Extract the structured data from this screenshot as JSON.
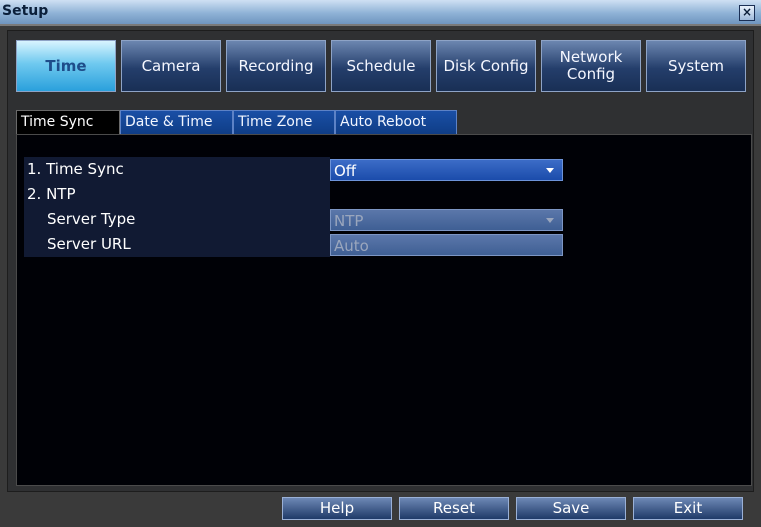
{
  "window": {
    "title": "Setup",
    "close_icon": "close-icon"
  },
  "main_tabs": [
    {
      "label": "Time",
      "active": true
    },
    {
      "label": "Camera"
    },
    {
      "label": "Recording"
    },
    {
      "label": "Schedule"
    },
    {
      "label": "Disk Config"
    },
    {
      "label": "Network Config"
    },
    {
      "label": "System"
    }
  ],
  "sub_tabs": [
    {
      "label": "Time Sync",
      "active": true
    },
    {
      "label": "Date & Time"
    },
    {
      "label": "Time Zone"
    },
    {
      "label": "Auto Reboot"
    }
  ],
  "settings": {
    "time_sync": {
      "label": "1. Time Sync",
      "value": "Off"
    },
    "ntp": {
      "label": "2. NTP"
    },
    "server_type": {
      "label": "Server Type",
      "value": "NTP"
    },
    "server_url": {
      "label": "Server URL",
      "value": "Auto"
    }
  },
  "buttons": {
    "help": "Help",
    "reset": "Reset",
    "save": "Save",
    "exit": "Exit"
  }
}
